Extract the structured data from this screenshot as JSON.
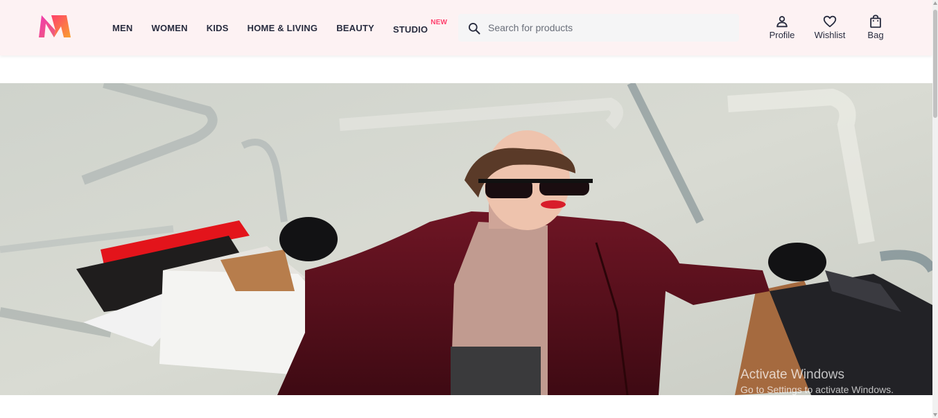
{
  "header": {
    "logo": {
      "name": "myntra-logo",
      "colors": {
        "left": "#f13ab1",
        "right": "#f9a02e",
        "mid": "#ff3f6c"
      }
    },
    "nav": [
      {
        "label": "MEN"
      },
      {
        "label": "WOMEN"
      },
      {
        "label": "KIDS"
      },
      {
        "label": "HOME & LIVING"
      },
      {
        "label": "BEAUTY"
      },
      {
        "label": "STUDIO",
        "badge": "NEW"
      }
    ],
    "search": {
      "placeholder": "Search for products",
      "value": "",
      "icon": "search-icon"
    },
    "actions": [
      {
        "label": "Profile",
        "icon": "person-icon"
      },
      {
        "label": "Wishlist",
        "icon": "heart-icon"
      },
      {
        "label": "Bag",
        "icon": "shopping-bag-icon"
      }
    ]
  },
  "hero": {
    "image": "woman-with-shopping-bags-banner"
  },
  "watermark": {
    "title": "Activate Windows",
    "subtitle": "Go to Settings to activate Windows."
  },
  "colors": {
    "accent": "#ff3f6c",
    "header_bg": "#fdf2f3",
    "text": "#282c3f"
  }
}
